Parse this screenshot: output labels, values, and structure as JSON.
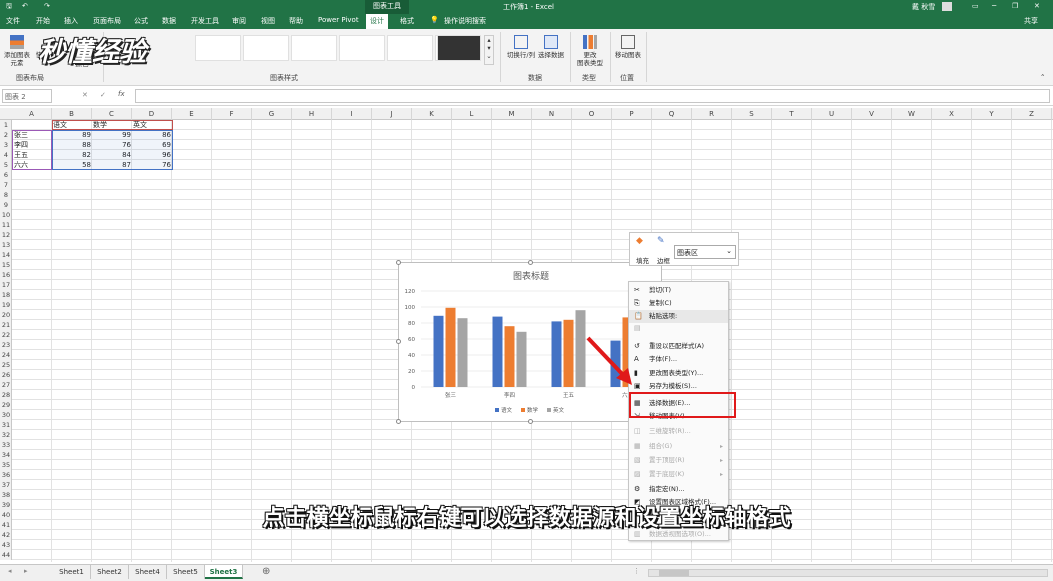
{
  "titlebar": {
    "chart_tools": "图表工具",
    "doc_title": "工作簿1 - Excel",
    "user": "戴 秋雪",
    "share": "共享"
  },
  "tabs": [
    "文件",
    "开始",
    "插入",
    "页面布局",
    "公式",
    "数据",
    "开发工具",
    "审阅",
    "视图",
    "帮助",
    "Power Pivot",
    "设计",
    "格式"
  ],
  "tell_me": "操作说明搜索",
  "ribbon": {
    "add_element": "添加图表\n元素",
    "quick_layout": "快",
    "change_colors": "颜色",
    "group_layouts": "图表布局",
    "group_styles": "图表样式",
    "switch_row_col": "切换行/列",
    "select_data": "选择数据",
    "group_data": "数据",
    "change_type": "更改\n图表类型",
    "group_type": "类型",
    "move_chart": "移动图表",
    "group_location": "位置"
  },
  "watermark": "秒懂经验",
  "formula": {
    "namebox": "图表 2",
    "fx": "fx"
  },
  "columns": [
    "A",
    "B",
    "C",
    "D",
    "E",
    "F",
    "G",
    "H",
    "I",
    "J",
    "K",
    "L",
    "M",
    "N",
    "O",
    "P",
    "Q",
    "R",
    "S",
    "T",
    "U",
    "V",
    "W",
    "X",
    "Y",
    "Z"
  ],
  "table": {
    "headers": [
      "语文",
      "数学",
      "英文"
    ],
    "rows": [
      {
        "name": "张三",
        "values": [
          "89",
          "99",
          "86"
        ]
      },
      {
        "name": "李四",
        "values": [
          "88",
          "76",
          "69"
        ]
      },
      {
        "name": "王五",
        "values": [
          "82",
          "84",
          "96"
        ]
      },
      {
        "name": "六六",
        "values": [
          "58",
          "87",
          "76"
        ]
      }
    ]
  },
  "chart_data": {
    "type": "bar",
    "title": "图表标题",
    "categories": [
      "张三",
      "李四",
      "王五",
      "六六"
    ],
    "series": [
      {
        "name": "语文",
        "values": [
          89,
          88,
          82,
          58
        ],
        "color": "#4472c4"
      },
      {
        "name": "数学",
        "values": [
          99,
          76,
          84,
          87
        ],
        "color": "#ed7d31"
      },
      {
        "name": "英文",
        "values": [
          86,
          69,
          96,
          76
        ],
        "color": "#a5a5a5"
      }
    ],
    "ylim": [
      0,
      120
    ],
    "yticks": [
      "0",
      "20",
      "40",
      "60",
      "80",
      "100",
      "120"
    ],
    "grid": true,
    "legend": "bottom",
    "visible_category_labels": [
      "张三",
      "李四",
      "王五",
      "六六"
    ]
  },
  "minitoolbar": {
    "fill": "填充",
    "outline": "边框",
    "area": "图表区"
  },
  "context_menu": [
    {
      "label": "剪切(T)",
      "icon": "scissors-icon",
      "disabled": false
    },
    {
      "label": "复制(C)",
      "icon": "copy-icon",
      "disabled": false
    },
    {
      "label": "粘贴选项:",
      "icon": "paste-icon",
      "disabled": false,
      "header": true
    },
    {
      "label": "",
      "icon": "paste-option-icon",
      "disabled": true
    },
    {
      "label": "重设以匹配样式(A)",
      "icon": "reset-icon",
      "disabled": false
    },
    {
      "label": "字体(F)...",
      "icon": "font-icon",
      "disabled": false
    },
    {
      "label": "更改图表类型(Y)...",
      "icon": "chart-type-icon",
      "disabled": false
    },
    {
      "label": "另存为模板(S)...",
      "icon": "template-icon",
      "disabled": false
    },
    {
      "label": "选择数据(E)...",
      "icon": "select-data-icon",
      "disabled": false
    },
    {
      "label": "移动图表(V)...",
      "icon": "move-chart-icon",
      "disabled": false
    },
    {
      "label": "三维旋转(R)...",
      "icon": "rotate-icon",
      "disabled": true
    },
    {
      "label": "组合(G)",
      "icon": "group-icon",
      "disabled": true,
      "submenu": true
    },
    {
      "label": "置于顶层(R)",
      "icon": "front-icon",
      "disabled": true,
      "submenu": true
    },
    {
      "label": "置于底层(K)",
      "icon": "back-icon",
      "disabled": true,
      "submenu": true
    },
    {
      "label": "指定宏(N)...",
      "icon": "macro-icon",
      "disabled": false
    },
    {
      "label": "设置图表区域格式(F)...",
      "icon": "format-icon",
      "disabled": false
    },
    {
      "label": "数据透视图选项(O)...",
      "icon": "pivot-icon",
      "disabled": true
    }
  ],
  "subtitle": "点击横坐标鼠标右键可以选择数据源和设置坐标轴格式",
  "sheets": [
    "Sheet1",
    "Sheet2",
    "Sheet4",
    "Sheet5",
    "Sheet3"
  ],
  "active_sheet": "Sheet3",
  "colors": {
    "excel_green": "#217346",
    "highlight_red": "#e0191a"
  }
}
